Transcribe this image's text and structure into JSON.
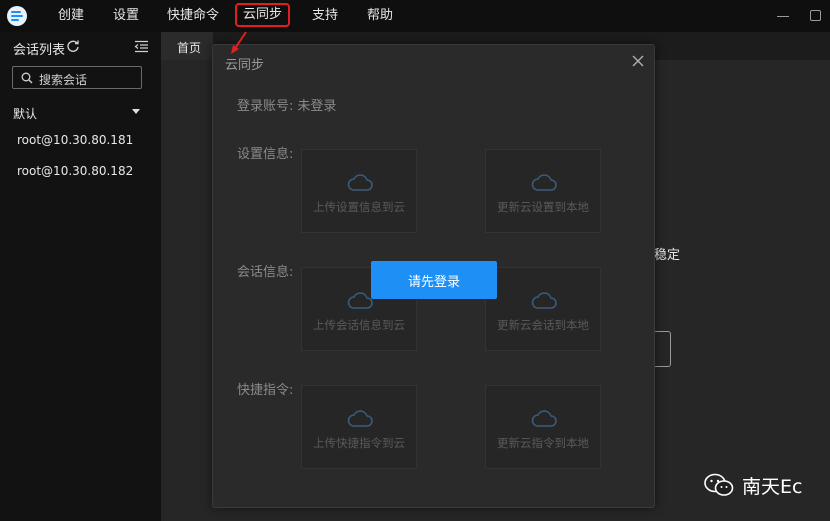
{
  "menu": {
    "items": [
      "创建",
      "设置",
      "快捷命令",
      "云同步",
      "支持",
      "帮助"
    ]
  },
  "sidebar": {
    "title": "会话列表",
    "search_placeholder": "搜索会话",
    "group": "默认",
    "sessions": [
      "root@10.30.80.181",
      "root@10.30.80.182"
    ]
  },
  "tabs": {
    "home": "首页"
  },
  "main": {
    "text": "稳定"
  },
  "dialog": {
    "title": "云同步",
    "account_label": "登录账号:",
    "account_value": "未登录",
    "sections": [
      {
        "label": "设置信息:",
        "upload": "上传设置信息到云",
        "download": "更新云设置到本地"
      },
      {
        "label": "会话信息:",
        "upload": "上传会话信息到云",
        "download": "更新云会话到本地"
      },
      {
        "label": "快捷指令:",
        "upload": "上传快捷指令到云",
        "download": "更新云指令到本地"
      }
    ],
    "login_button": "请先登录"
  },
  "watermark": {
    "text": "南天Ec"
  },
  "colors": {
    "accent": "#1e8ff5",
    "highlight": "#e02020",
    "background": "#1e1e1e"
  }
}
